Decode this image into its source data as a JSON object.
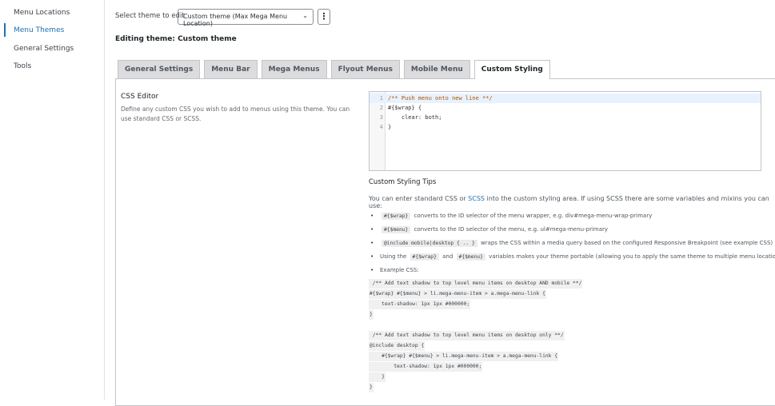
{
  "sidebar": {
    "items": [
      {
        "label": "Menu Locations"
      },
      {
        "label": "Menu Themes",
        "active": true
      },
      {
        "label": "General Settings"
      },
      {
        "label": "Tools"
      }
    ]
  },
  "theme_select": {
    "label": "Select theme to edit",
    "value": "Custom theme (Max Mega Menu Location)",
    "more_icon": "vertical-dots-icon"
  },
  "editing_title": "Editing theme: Custom theme",
  "tabs": [
    {
      "label": "General Settings"
    },
    {
      "label": "Menu Bar"
    },
    {
      "label": "Mega Menus"
    },
    {
      "label": "Flyout Menus"
    },
    {
      "label": "Mobile Menu"
    },
    {
      "label": "Custom Styling",
      "active": true
    }
  ],
  "css_editor": {
    "title": "CSS Editor",
    "description": "Define any custom CSS you wish to add to menus using this theme. You can use standard CSS or SCSS.",
    "lines": [
      {
        "n": "1",
        "text": "/** Push menu onto new line **/"
      },
      {
        "n": "2",
        "text": "#{$wrap} {"
      },
      {
        "n": "3",
        "text": "    clear: both;"
      },
      {
        "n": "4",
        "text": "}"
      }
    ]
  },
  "tips": {
    "title": "Custom Styling Tips",
    "intro_pre": "You can enter standard CSS or ",
    "intro_link": "SCSS",
    "intro_post": " into the custom styling area. If using SCSS there are some variables and mixins you can use:",
    "bullets": [
      {
        "code": "#{$wrap}",
        "text": "converts to the ID selector of the menu wrapper, e.g. div#mega-menu-wrap-primary"
      },
      {
        "code": "#{$menu}",
        "text": "converts to the ID selector of the menu, e.g. ul#mega-menu-primary"
      },
      {
        "code": "@include mobile|desktop { .. }",
        "text": "wraps the CSS within a media query based on the configured Responsive Breakpoint (see example CSS)"
      },
      {
        "pre": "Using the",
        "code1": "#{$wrap}",
        "mid": "and",
        "code2": "#{$menu}",
        "text": "variables makes your theme portable (allowing you to apply the same theme to multiple menu locations)"
      },
      {
        "text": "Example CSS:"
      }
    ],
    "example": [
      " /** Add text shadow to top level menu items on desktop AND mobile **/",
      "#{$wrap} #{$menu} > li.mega-menu-item > a.mega-menu-link {",
      "    text-shadow: 1px 1px #000000;",
      "}",
      " /** Add text shadow to top level menu items on desktop only **/",
      "@include desktop {",
      "    #{$wrap} #{$menu} > li.mega-menu-item > a.mega-menu-link {",
      "        text-shadow: 1px 1px #000000;",
      "    }",
      "}"
    ]
  },
  "colors": {
    "accent": "#2271b1",
    "tab_bg": "#dcdcde"
  }
}
